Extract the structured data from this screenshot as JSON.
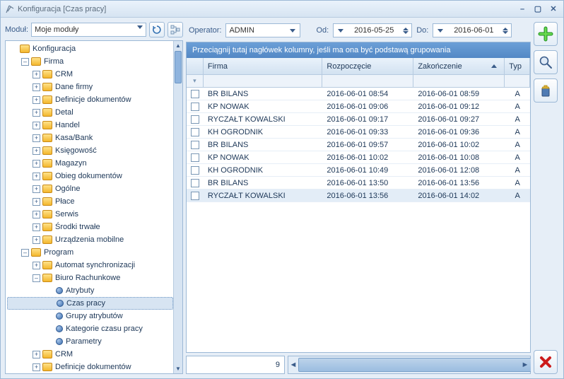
{
  "window": {
    "title": "Konfiguracja [Czas pracy]"
  },
  "module_bar": {
    "label": "Moduł:",
    "value": "Moje moduły"
  },
  "tree": {
    "root": "Konfiguracja",
    "firma_label": "Firma",
    "firma_children": [
      "CRM",
      "Dane firmy",
      "Definicje dokumentów",
      "Detal",
      "Handel",
      "Kasa/Bank",
      "Księgowość",
      "Magazyn",
      "Obieg dokumentów",
      "Ogólne",
      "Płace",
      "Serwis",
      "Środki trwałe",
      "Urządzenia mobilne"
    ],
    "program_label": "Program",
    "program_children_simple": [
      "Automat synchronizacji"
    ],
    "biuro_label": "Biuro Rachunkowe",
    "biuro_children": [
      "Atrybuty",
      "Czas pracy",
      "Grupy atrybutów",
      "Kategorie czasu pracy",
      "Parametry"
    ],
    "program_tail": [
      "CRM",
      "Definicje dokumentów"
    ],
    "selected": "Czas pracy"
  },
  "filter": {
    "operator_label": "Operator:",
    "operator_value": "ADMIN",
    "od_label": "Od:",
    "od_value": "2016-05-25",
    "do_label": "Do:",
    "do_value": "2016-06-01"
  },
  "grid": {
    "group_hint": "Przeciągnij tutaj nagłówek kolumny, jeśli ma ona być podstawą grupowania",
    "headers": {
      "firma": "Firma",
      "start": "Rozpoczęcie",
      "end": "Zakończenie",
      "typ": "Typ"
    },
    "rows": [
      {
        "firma": "BR BILANS",
        "start": "2016-06-01 08:54",
        "end": "2016-06-01 08:59",
        "typ": "A"
      },
      {
        "firma": "KP NOWAK",
        "start": "2016-06-01 09:06",
        "end": "2016-06-01 09:12",
        "typ": "A"
      },
      {
        "firma": "RYCZAŁT KOWALSKI",
        "start": "2016-06-01 09:17",
        "end": "2016-06-01 09:27",
        "typ": "A"
      },
      {
        "firma": "KH OGRODNIK",
        "start": "2016-06-01 09:33",
        "end": "2016-06-01 09:36",
        "typ": "A"
      },
      {
        "firma": "BR BILANS",
        "start": "2016-06-01 09:57",
        "end": "2016-06-01 10:02",
        "typ": "A"
      },
      {
        "firma": "KP NOWAK",
        "start": "2016-06-01 10:02",
        "end": "2016-06-01 10:08",
        "typ": "A"
      },
      {
        "firma": "KH OGRODNIK",
        "start": "2016-06-01 10:49",
        "end": "2016-06-01 12:08",
        "typ": "A"
      },
      {
        "firma": "BR BILANS",
        "start": "2016-06-01 13:50",
        "end": "2016-06-01 13:56",
        "typ": "A"
      },
      {
        "firma": "RYCZAŁT KOWALSKI",
        "start": "2016-06-01 13:56",
        "end": "2016-06-01 14:02",
        "typ": "A"
      }
    ],
    "count": "9"
  },
  "icons": {
    "plus": "+",
    "magnifier": "search",
    "trash": "trash",
    "close": "✕",
    "refresh": "↻"
  }
}
